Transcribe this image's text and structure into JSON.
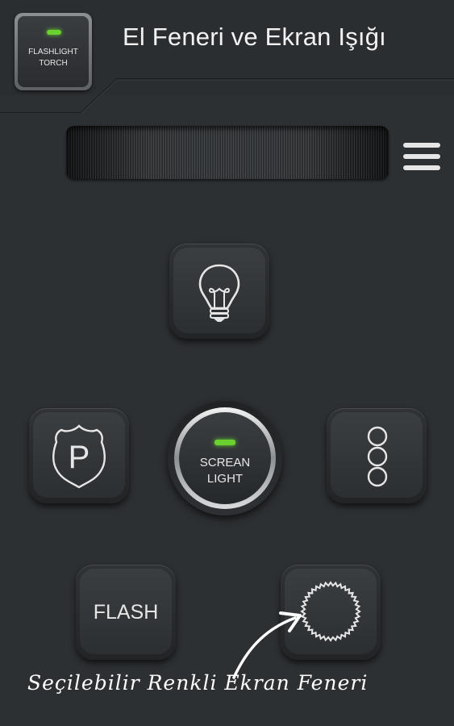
{
  "app_icon": {
    "line1": "FLASHLIGHT",
    "line2": "TORCH"
  },
  "header": {
    "title": "El Feneri ve Ekran Işığı"
  },
  "menu": {
    "icon": "hamburger-menu-icon"
  },
  "buttons": {
    "bulb": {
      "icon": "light-bulb-icon"
    },
    "police": {
      "icon": "police-badge-icon",
      "glyph": "P"
    },
    "screen_light": {
      "line1": "SCREAN",
      "line2": "LIGHT"
    },
    "traffic": {
      "icon": "traffic-light-icon"
    },
    "flash": {
      "label": "FLASH"
    },
    "color": {
      "icon": "color-wheel-icon"
    }
  },
  "caption": "Seçilebilir Renkli Ekran Feneri",
  "colors": {
    "background": "#2d3033",
    "led": "#6ad131",
    "text": "#f2f2f2"
  }
}
